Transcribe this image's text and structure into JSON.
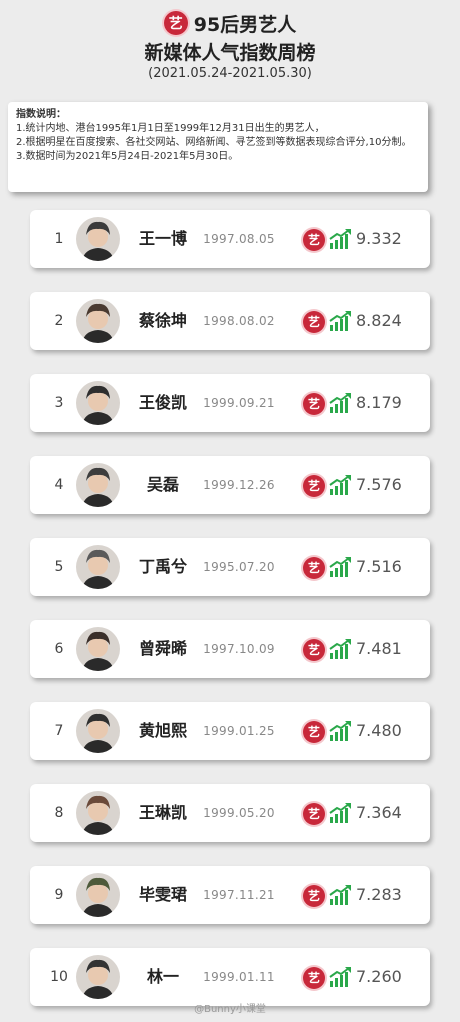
{
  "header": {
    "brand_glyph": "艺",
    "title_line1": "95后男艺人",
    "title_line2": "新媒体人气指数周榜",
    "date_range": "(2021.05.24-2021.05.30)"
  },
  "notes": {
    "title": "指数说明：",
    "items": [
      "1.统计内地、港台1995年1月1日至1999年12月31日出生的男艺人，",
      "2.根据明星在百度搜索、各社交网站、网络新闻、寻艺签到等数据表现综合评分,10分制。",
      "3.数据时间为2021年5月24日-2021年5月30日。"
    ]
  },
  "ranking": [
    {
      "rank": "1",
      "name": "王一博",
      "birth": "1997.08.05",
      "score": "9.332"
    },
    {
      "rank": "2",
      "name": "蔡徐坤",
      "birth": "1998.08.02",
      "score": "8.824"
    },
    {
      "rank": "3",
      "name": "王俊凯",
      "birth": "1999.09.21",
      "score": "8.179"
    },
    {
      "rank": "4",
      "name": "吴磊",
      "birth": "1999.12.26",
      "score": "7.576"
    },
    {
      "rank": "5",
      "name": "丁禹兮",
      "birth": "1995.07.20",
      "score": "7.516"
    },
    {
      "rank": "6",
      "name": "曾舜晞",
      "birth": "1997.10.09",
      "score": "7.481"
    },
    {
      "rank": "7",
      "name": "黄旭熙",
      "birth": "1999.01.25",
      "score": "7.480"
    },
    {
      "rank": "8",
      "name": "王琳凯",
      "birth": "1999.05.20",
      "score": "7.364"
    },
    {
      "rank": "9",
      "name": "毕雯珺",
      "birth": "1997.11.21",
      "score": "7.283"
    },
    {
      "rank": "10",
      "name": "林一",
      "birth": "1999.01.11",
      "score": "7.260"
    }
  ],
  "icons": {
    "brand_icon": "yi-brand-icon",
    "trend_icon": "trend-up-icon",
    "avatar": "portrait-avatar"
  },
  "colors": {
    "brand_red": "#c8283a",
    "trend_green": "#2aa84a",
    "background": "#ececec"
  },
  "watermark": "@Bunny小课堂"
}
